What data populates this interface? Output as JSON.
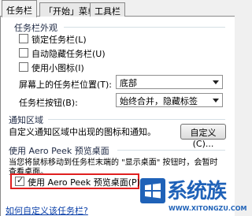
{
  "tabs": [
    {
      "label": "任务栏"
    },
    {
      "label": "「开始」菜单"
    },
    {
      "label": "工具栏"
    }
  ],
  "taskbar_appearance": {
    "title": "任务栏外观",
    "lock_taskbar": {
      "label": "锁定任务栏(L)",
      "checked": false
    },
    "auto_hide": {
      "label": "自动隐藏任务栏(U)",
      "checked": false
    },
    "small_icons": {
      "label": "使用小图标(I)",
      "checked": false
    },
    "location_label": "屏幕上的任务栏位置(T):",
    "location_value": "底部",
    "buttons_label": "任务栏按钮(B):",
    "buttons_value": "始终合并，隐藏标签"
  },
  "notification_area": {
    "title": "通知区域",
    "description": "自定义通知区域中出现的图标和通知。",
    "customize_button": "自定义(C)..."
  },
  "aero_peek": {
    "title": "使用 Aero Peek 预览桌面",
    "description_line1": "当您将鼠标移动到任务栏末端的 \"显示桌面\" 按钮时，会暂时",
    "description_line2": "查看桌面。",
    "checkbox_label": "使用 Aero Peek 预览桌面(P)",
    "checked": true
  },
  "help_link": "如何自定义该任务栏?",
  "watermark": {
    "title": "系统族",
    "url": "WWW.XITONGZU.COM"
  }
}
